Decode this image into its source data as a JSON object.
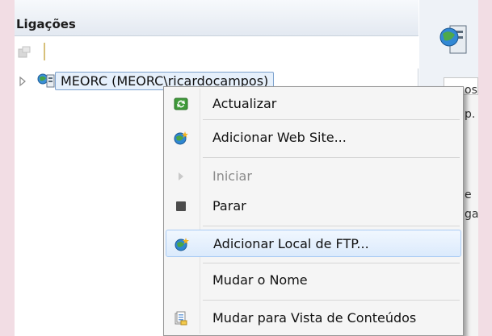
{
  "connections": {
    "title": "Ligações",
    "tree": {
      "server_label": "MEORC (MEORC\\ricardocampos)"
    }
  },
  "context_menu": {
    "items": [
      {
        "label": "Actualizar",
        "icon": "refresh-icon",
        "enabled": true
      },
      {
        "label": "Adicionar Web Site...",
        "icon": "globe-add-icon",
        "enabled": true
      },
      {
        "label": "Iniciar",
        "icon": "play-icon",
        "enabled": false
      },
      {
        "label": "Parar",
        "icon": "stop-icon",
        "enabled": true
      },
      {
        "label": "Adicionar Local de FTP...",
        "icon": "globe-add-icon",
        "enabled": true,
        "highlighted": true
      },
      {
        "label": "Mudar o Nome",
        "icon": "",
        "enabled": true
      },
      {
        "label": "Mudar para Vista de Conteúdos",
        "icon": "content-view-icon",
        "enabled": true
      }
    ]
  },
  "right_panel": {
    "fragments": [
      "os",
      "p.",
      "e",
      "ga"
    ]
  },
  "colors": {
    "highlight_border": "#a9cbf4",
    "selection_fill": "#e6f0fb",
    "background_pink": "#f2dde4"
  }
}
